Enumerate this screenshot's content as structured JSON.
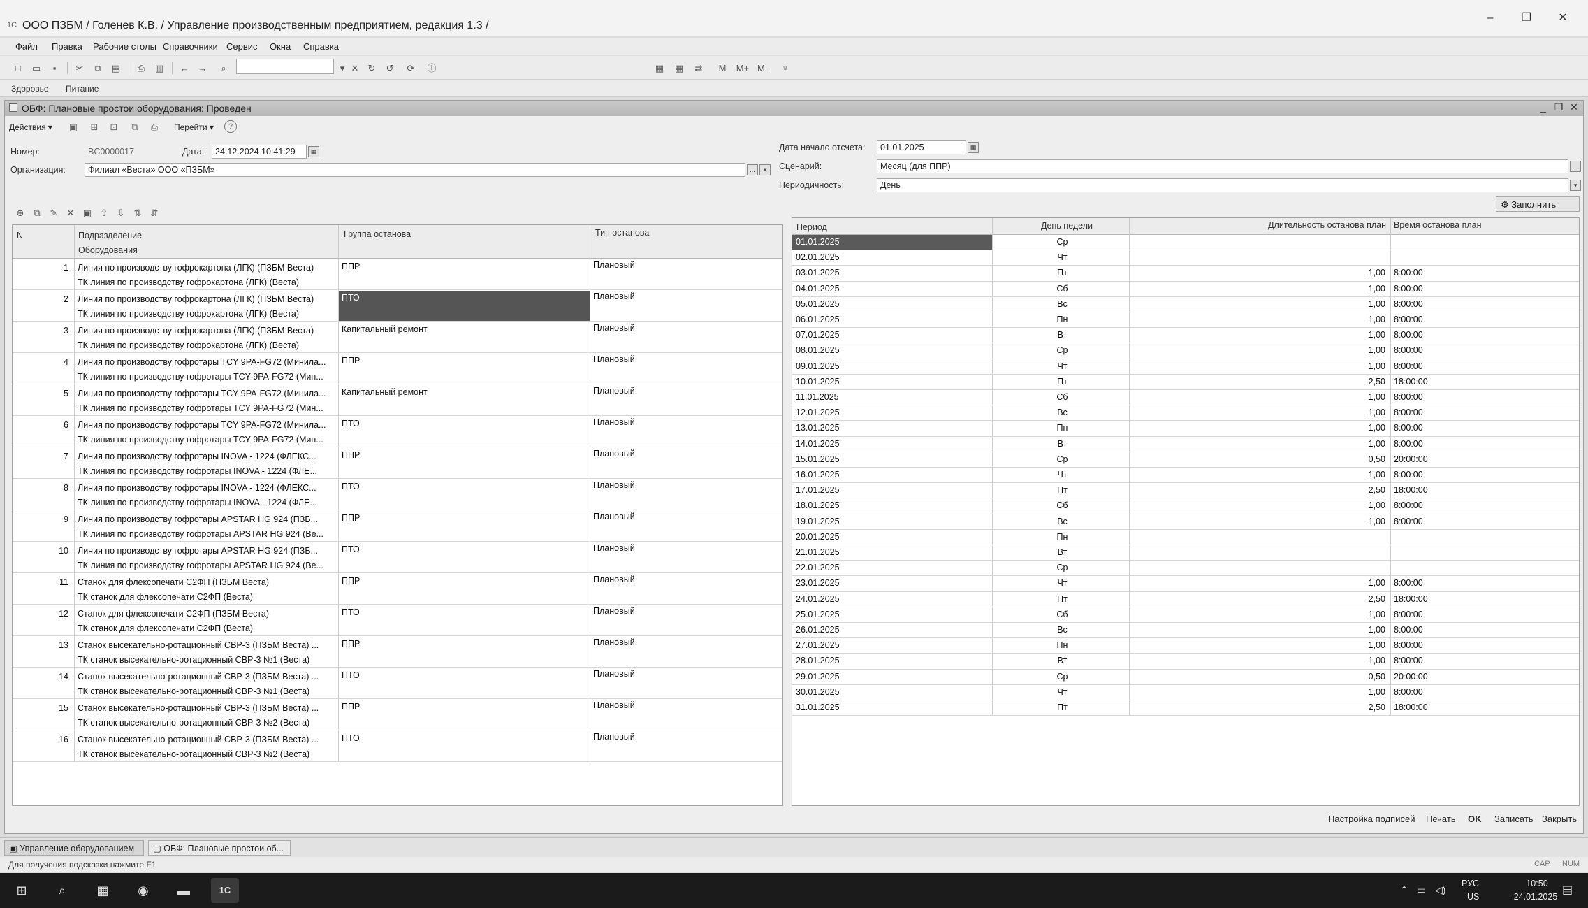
{
  "window": {
    "title": "ООО ПЗБМ / Голенев К.В. / Управление производственным предприятием, редакция 1.3 /",
    "app_icon": "1С",
    "minimize": "–",
    "restore": "❐",
    "close": "✕"
  },
  "menu": [
    "Файл",
    "Правка",
    "Рабочие столы",
    "Справочники",
    "Сервис",
    "Окна",
    "Справка"
  ],
  "toolbar_right": {
    "m": "M",
    "mplus": "M+",
    "mminus": "M–"
  },
  "panels": {
    "health": "Здоровье",
    "food": "Питание"
  },
  "document": {
    "title": "ОБФ: Плановые простои оборудования: Проведен",
    "actions_label": "Действия",
    "goto_label": "Перейти",
    "help_icon": "?",
    "number_label": "Номер:",
    "number_value": "BC0000017",
    "date_label": "Дата:",
    "date_value": "24.12.2024 10:41:29",
    "org_label": "Организация:",
    "org_value": "Филиал «Веста» ООО «ПЗБМ»",
    "start_date_label": "Дата начало отсчета:",
    "start_date_value": "01.01.2025",
    "scenario_label": "Сценарий:",
    "scenario_value": "Месяц (для ППР)",
    "periodicity_label": "Периодичность:",
    "periodicity_value": "День",
    "fill_button": "Заполнить",
    "field_dots": "...",
    "field_clear": "✕"
  },
  "left_grid": {
    "headers": {
      "n": "N",
      "division": "Подразделение",
      "equipment": "Оборудования",
      "group": "Группа останова",
      "type": "Тип останова"
    },
    "rows": [
      {
        "n": "1",
        "division": "Линия по производству гофрокартона (ЛГК) (ПЗБМ Веста)",
        "equipment": "ТК линия по производству гофрокартона (ЛГК) (Веста)",
        "group": "ППР",
        "type": "Плановый"
      },
      {
        "n": "2",
        "division": "Линия по производству гофрокартона (ЛГК) (ПЗБМ Веста)",
        "equipment": "ТК линия по производству гофрокартона (ЛГК) (Веста)",
        "group": "ПТО",
        "type": "Плановый"
      },
      {
        "n": "3",
        "division": "Линия по производству гофрокартона (ЛГК) (ПЗБМ Веста)",
        "equipment": "ТК линия по производству гофрокартона (ЛГК) (Веста)",
        "group": "Капитальный ремонт",
        "type": "Плановый"
      },
      {
        "n": "4",
        "division": "Линия по производству гофротары TCY 9PA-FG72 (Минила...",
        "equipment": "ТК линия по производству гофротары TCY 9PA-FG72 (Мин...",
        "group": "ППР",
        "type": "Плановый"
      },
      {
        "n": "5",
        "division": "Линия по производству гофротары TCY 9PA-FG72 (Минила...",
        "equipment": "ТК линия по производству гофротары TCY 9PA-FG72 (Мин...",
        "group": "Капитальный ремонт",
        "type": "Плановый"
      },
      {
        "n": "6",
        "division": "Линия по производству гофротары TCY 9PA-FG72 (Минила...",
        "equipment": "ТК линия по производству гофротары TCY 9PA-FG72 (Мин...",
        "group": "ПТО",
        "type": "Плановый"
      },
      {
        "n": "7",
        "division": "Линия по производству гофротары INOVA - 1224 (ФЛЕКС...",
        "equipment": "ТК линия по производству гофротары INOVA - 1224 (ФЛЕ...",
        "group": "ППР",
        "type": "Плановый"
      },
      {
        "n": "8",
        "division": "Линия по производству гофротары INOVA - 1224 (ФЛЕКС...",
        "equipment": "ТК линия по производству гофротары INOVA - 1224 (ФЛЕ...",
        "group": "ПТО",
        "type": "Плановый"
      },
      {
        "n": "9",
        "division": "Линия по производству гофротары APSTAR HG 924 (ПЗБ...",
        "equipment": "ТК линия по производству гофротары APSTAR HG 924 (Ве...",
        "group": "ППР",
        "type": "Плановый"
      },
      {
        "n": "10",
        "division": "Линия по производству гофротары APSTAR HG 924 (ПЗБ...",
        "equipment": "ТК линия по производству гофротары APSTAR HG 924 (Ве...",
        "group": "ПТО",
        "type": "Плановый"
      },
      {
        "n": "11",
        "division": "Станок для флексопечати С2ФП (ПЗБМ Веста)",
        "equipment": "ТК станок для флексопечати С2ФП (Веста)",
        "group": "ППР",
        "type": "Плановый"
      },
      {
        "n": "12",
        "division": "Станок для флексопечати С2ФП (ПЗБМ Веста)",
        "equipment": "ТК станок для флексопечати С2ФП (Веста)",
        "group": "ПТО",
        "type": "Плановый"
      },
      {
        "n": "13",
        "division": "Станок высекательно-ротационный СВР-3 (ПЗБМ Веста) ...",
        "equipment": "ТК станок высекательно-ротационный СВР-3 №1 (Веста)",
        "group": "ППР",
        "type": "Плановый"
      },
      {
        "n": "14",
        "division": "Станок высекательно-ротационный СВР-3 (ПЗБМ Веста) ...",
        "equipment": "ТК станок высекательно-ротационный СВР-3 №1 (Веста)",
        "group": "ПТО",
        "type": "Плановый"
      },
      {
        "n": "15",
        "division": "Станок высекательно-ротационный СВР-3 (ПЗБМ Веста) ...",
        "equipment": "ТК станок высекательно-ротационный СВР-3 №2 (Веста)",
        "group": "ППР",
        "type": "Плановый"
      },
      {
        "n": "16",
        "division": "Станок высекательно-ротационный СВР-3 (ПЗБМ Веста) ...",
        "equipment": "ТК станок высекательно-ротационный СВР-3 №2 (Веста)",
        "group": "ПТО",
        "type": "Плановый"
      }
    ]
  },
  "right_grid": {
    "headers": {
      "period": "Период",
      "weekday": "День недели",
      "duration": "Длительность останова план",
      "time": "Время останова план"
    },
    "rows": [
      {
        "period": "01.01.2025",
        "weekday": "Ср",
        "duration": "",
        "time": ""
      },
      {
        "period": "02.01.2025",
        "weekday": "Чт",
        "duration": "",
        "time": ""
      },
      {
        "period": "03.01.2025",
        "weekday": "Пт",
        "duration": "1,00",
        "time": "8:00:00"
      },
      {
        "period": "04.01.2025",
        "weekday": "Сб",
        "duration": "1,00",
        "time": "8:00:00"
      },
      {
        "period": "05.01.2025",
        "weekday": "Вс",
        "duration": "1,00",
        "time": "8:00:00"
      },
      {
        "period": "06.01.2025",
        "weekday": "Пн",
        "duration": "1,00",
        "time": "8:00:00"
      },
      {
        "period": "07.01.2025",
        "weekday": "Вт",
        "duration": "1,00",
        "time": "8:00:00"
      },
      {
        "period": "08.01.2025",
        "weekday": "Ср",
        "duration": "1,00",
        "time": "8:00:00"
      },
      {
        "period": "09.01.2025",
        "weekday": "Чт",
        "duration": "1,00",
        "time": "8:00:00"
      },
      {
        "period": "10.01.2025",
        "weekday": "Пт",
        "duration": "2,50",
        "time": "18:00:00"
      },
      {
        "period": "11.01.2025",
        "weekday": "Сб",
        "duration": "1,00",
        "time": "8:00:00"
      },
      {
        "period": "12.01.2025",
        "weekday": "Вс",
        "duration": "1,00",
        "time": "8:00:00"
      },
      {
        "period": "13.01.2025",
        "weekday": "Пн",
        "duration": "1,00",
        "time": "8:00:00"
      },
      {
        "period": "14.01.2025",
        "weekday": "Вт",
        "duration": "1,00",
        "time": "8:00:00"
      },
      {
        "period": "15.01.2025",
        "weekday": "Ср",
        "duration": "0,50",
        "time": "20:00:00"
      },
      {
        "period": "16.01.2025",
        "weekday": "Чт",
        "duration": "1,00",
        "time": "8:00:00"
      },
      {
        "period": "17.01.2025",
        "weekday": "Пт",
        "duration": "2,50",
        "time": "18:00:00"
      },
      {
        "period": "18.01.2025",
        "weekday": "Сб",
        "duration": "1,00",
        "time": "8:00:00"
      },
      {
        "period": "19.01.2025",
        "weekday": "Вс",
        "duration": "1,00",
        "time": "8:00:00"
      },
      {
        "period": "20.01.2025",
        "weekday": "Пн",
        "duration": "",
        "time": ""
      },
      {
        "period": "21.01.2025",
        "weekday": "Вт",
        "duration": "",
        "time": ""
      },
      {
        "period": "22.01.2025",
        "weekday": "Ср",
        "duration": "",
        "time": ""
      },
      {
        "period": "23.01.2025",
        "weekday": "Чт",
        "duration": "1,00",
        "time": "8:00:00"
      },
      {
        "period": "24.01.2025",
        "weekday": "Пт",
        "duration": "2,50",
        "time": "18:00:00"
      },
      {
        "period": "25.01.2025",
        "weekday": "Сб",
        "duration": "1,00",
        "time": "8:00:00"
      },
      {
        "period": "26.01.2025",
        "weekday": "Вс",
        "duration": "1,00",
        "time": "8:00:00"
      },
      {
        "period": "27.01.2025",
        "weekday": "Пн",
        "duration": "1,00",
        "time": "8:00:00"
      },
      {
        "period": "28.01.2025",
        "weekday": "Вт",
        "duration": "1,00",
        "time": "8:00:00"
      },
      {
        "period": "29.01.2025",
        "weekday": "Ср",
        "duration": "0,50",
        "time": "20:00:00"
      },
      {
        "period": "30.01.2025",
        "weekday": "Чт",
        "duration": "1,00",
        "time": "8:00:00"
      },
      {
        "period": "31.01.2025",
        "weekday": "Пт",
        "duration": "2,50",
        "time": "18:00:00"
      }
    ]
  },
  "bottom_buttons": {
    "signatures": "Настройка подписей",
    "print": "Печать",
    "ok": "OK",
    "save": "Записать",
    "close": "Закрыть"
  },
  "window_tabs": [
    "Управление оборудованием",
    "ОБФ: Плановые простои об..."
  ],
  "status": {
    "hint": "Для получения подсказки нажмите F1",
    "cap": "CAP",
    "num": "NUM"
  },
  "taskbar": {
    "lang_top": "РУС",
    "lang_bottom": "US",
    "time": "10:50",
    "date": "24.01.2025",
    "app_1c": "1C"
  },
  "colors": {
    "selection_dark": "#555555",
    "selection_period": "#5a5a5a"
  }
}
